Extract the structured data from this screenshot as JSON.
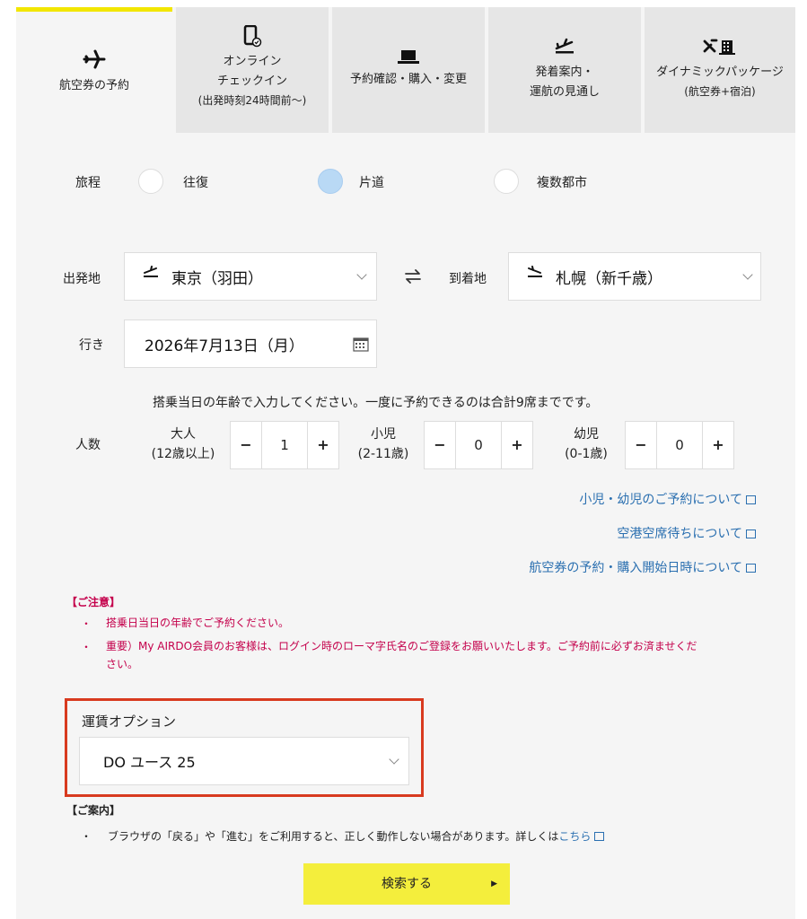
{
  "tabs": [
    {
      "icon": "airplane-icon",
      "line1": "航空券の予約",
      "line2": "",
      "line3": ""
    },
    {
      "icon": "mobile-checkin-icon",
      "line1": "オンライン",
      "line2": "チェックイン",
      "line3": "(出発時刻24時間前〜)"
    },
    {
      "icon": "laptop-icon",
      "line1": "予約確認・購入・変更",
      "line2": "",
      "line3": ""
    },
    {
      "icon": "departure-icon",
      "line1": "発着案内・",
      "line2": "運航の見通し",
      "line3": ""
    },
    {
      "icon": "plane-hotel-icon",
      "line1": "ダイナミックパッケージ",
      "line2": "(航空券+宿泊)",
      "line3": ""
    }
  ],
  "itinerary": {
    "label": "旅程",
    "options": [
      "往復",
      "片道",
      "複数都市"
    ],
    "selected": "片道"
  },
  "route": {
    "from_label": "出発地",
    "from_value": "東京（羽田）",
    "to_label": "到着地",
    "to_value": "札幌（新千歳）"
  },
  "date": {
    "label": "行き",
    "value": "2026年7月13日（月）"
  },
  "passengers": {
    "note": "搭乗当日の年齢で入力してください。一度に予約できるのは合計9席までです。",
    "label": "人数",
    "categories": [
      {
        "name": "大人",
        "age": "(12歳以上)",
        "value": "1"
      },
      {
        "name": "小児",
        "age": "(2-11歳)",
        "value": "0"
      },
      {
        "name": "幼児",
        "age": "(0-1歳)",
        "value": "0"
      }
    ],
    "minus": "−",
    "plus": "+"
  },
  "links": [
    "小児・幼児のご予約について",
    "空港空席待ちについて",
    "航空券の予約・購入開始日時について"
  ],
  "notice": {
    "title": "【ご注意】",
    "bullet": "・",
    "items": [
      "搭乗日当日の年齢でご予約ください。",
      "重要）My AIRDO会員のお客様は、ログイン時のローマ字氏名のご登録をお願いいたします。ご予約前に必ずお済ませくだ",
      "さい。"
    ]
  },
  "fare_option": {
    "label": "運賃オプション",
    "value": "DO ユース 25"
  },
  "guide": {
    "title": "【ご案内】",
    "bullet": "・",
    "text": "ブラウザの「戻る」や「進む」をご利用すると、正しく動作しない場合があります。詳しくは",
    "link": "こちら"
  },
  "search_button": "検索する",
  "colors": {
    "accent_yellow": "#f4ee3c",
    "tab_indicator": "#f2e600",
    "notice_red": "#c4004b",
    "link_blue": "#2a6fb0",
    "highlight_border": "#d83a1f",
    "radio_selected": "#b9d9f5"
  }
}
